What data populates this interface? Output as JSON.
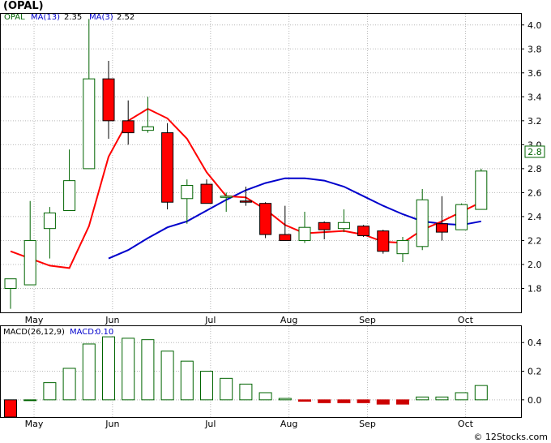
{
  "title": "(OPAL)",
  "footer": "© 12Stocks.com",
  "colors": {
    "up_candle": "#006400",
    "down_candle": "#ff0000",
    "ma13": "#0000cc",
    "ma3": "#ff0000",
    "macd_bar": "#006400",
    "macd_neg": "#cc0000",
    "grid": "#b8b8b8",
    "frame": "#000000",
    "axis_text": "#000000"
  },
  "chart_data": [
    {
      "type": "candlestick",
      "legend": {
        "symbol": "OPAL",
        "ma13_label": "MA(13)",
        "ma13_value": "2.35",
        "ma3_label": "MA(3)",
        "ma3_value": "2.52"
      },
      "last_price_label": "2.8",
      "y_ticks": [
        "1.8",
        "2.0",
        "2.2",
        "2.4",
        "2.6",
        "2.8",
        "3.0",
        "3.2",
        "3.4",
        "3.6",
        "3.8",
        "4.0"
      ],
      "ylim": [
        1.6,
        4.1
      ],
      "grid": true,
      "x_months": [
        {
          "label": "May",
          "index": 1.2
        },
        {
          "label": "Jun",
          "index": 5.2
        },
        {
          "label": "Jul",
          "index": 10.2
        },
        {
          "label": "Aug",
          "index": 14.2
        },
        {
          "label": "Sep",
          "index": 18.2
        },
        {
          "label": "Oct",
          "index": 23.2
        }
      ],
      "candles": [
        {
          "o": 1.8,
          "h": 1.86,
          "l": 1.63,
          "c": 1.88
        },
        {
          "o": 1.83,
          "h": 2.53,
          "l": 1.83,
          "c": 2.2
        },
        {
          "o": 2.3,
          "h": 2.48,
          "l": 2.05,
          "c": 2.43
        },
        {
          "o": 2.45,
          "h": 2.96,
          "l": 2.45,
          "c": 2.7
        },
        {
          "o": 2.8,
          "h": 4.05,
          "l": 2.8,
          "c": 3.55
        },
        {
          "o": 3.55,
          "h": 3.7,
          "l": 3.05,
          "c": 3.2
        },
        {
          "o": 3.2,
          "h": 3.37,
          "l": 3.0,
          "c": 3.1
        },
        {
          "o": 3.12,
          "h": 3.4,
          "l": 3.1,
          "c": 3.15
        },
        {
          "o": 3.1,
          "h": 3.18,
          "l": 2.46,
          "c": 2.52
        },
        {
          "o": 2.55,
          "h": 2.71,
          "l": 2.34,
          "c": 2.66
        },
        {
          "o": 2.67,
          "h": 2.71,
          "l": 2.51,
          "c": 2.51
        },
        {
          "o": 2.56,
          "h": 2.6,
          "l": 2.44,
          "c": 2.57
        },
        {
          "o": 2.53,
          "h": 2.65,
          "l": 2.49,
          "c": 2.52
        },
        {
          "o": 2.51,
          "h": 2.52,
          "l": 2.22,
          "c": 2.25
        },
        {
          "o": 2.25,
          "h": 2.49,
          "l": 2.2,
          "c": 2.2
        },
        {
          "o": 2.2,
          "h": 2.44,
          "l": 2.18,
          "c": 2.31
        },
        {
          "o": 2.35,
          "h": 2.36,
          "l": 2.21,
          "c": 2.29
        },
        {
          "o": 2.3,
          "h": 2.46,
          "l": 2.27,
          "c": 2.35
        },
        {
          "o": 2.32,
          "h": 2.33,
          "l": 2.23,
          "c": 2.24
        },
        {
          "o": 2.28,
          "h": 2.29,
          "l": 2.09,
          "c": 2.11
        },
        {
          "o": 2.09,
          "h": 2.23,
          "l": 2.02,
          "c": 2.2
        },
        {
          "o": 2.15,
          "h": 2.63,
          "l": 2.12,
          "c": 2.54
        },
        {
          "o": 2.34,
          "h": 2.57,
          "l": 2.2,
          "c": 2.27
        },
        {
          "o": 2.29,
          "h": 2.51,
          "l": 2.29,
          "c": 2.5
        },
        {
          "o": 2.46,
          "h": 2.8,
          "l": 2.46,
          "c": 2.78
        }
      ],
      "series": [
        {
          "name": "MA(13)",
          "values": [
            null,
            null,
            null,
            null,
            null,
            2.05,
            2.12,
            2.22,
            2.31,
            2.36,
            2.45,
            2.54,
            2.62,
            2.68,
            2.72,
            2.72,
            2.7,
            2.65,
            2.57,
            2.49,
            2.42,
            2.36,
            2.34,
            2.33,
            2.36
          ]
        },
        {
          "name": "MA(3)",
          "values": [
            2.11,
            2.05,
            1.99,
            1.97,
            2.32,
            2.9,
            3.2,
            3.3,
            3.22,
            3.05,
            2.77,
            2.57,
            2.56,
            2.46,
            2.33,
            2.26,
            2.27,
            2.28,
            2.25,
            2.19,
            2.18,
            2.29,
            2.36,
            2.44,
            2.52
          ]
        }
      ]
    },
    {
      "type": "bar",
      "legend": {
        "label": "MACD(26,12,9)",
        "macd_label": "MACD:",
        "macd_value": "0.10"
      },
      "y_ticks": [
        "0.0",
        "0.2",
        "0.4"
      ],
      "ylim": [
        -0.12,
        0.52
      ],
      "grid": true,
      "values": [
        -0.12,
        0.0,
        0.12,
        0.22,
        0.39,
        0.44,
        0.43,
        0.42,
        0.34,
        0.27,
        0.2,
        0.15,
        0.11,
        0.05,
        0.01,
        -0.01,
        -0.02,
        -0.02,
        -0.02,
        -0.03,
        -0.03,
        0.02,
        0.02,
        0.05,
        0.1
      ]
    }
  ]
}
